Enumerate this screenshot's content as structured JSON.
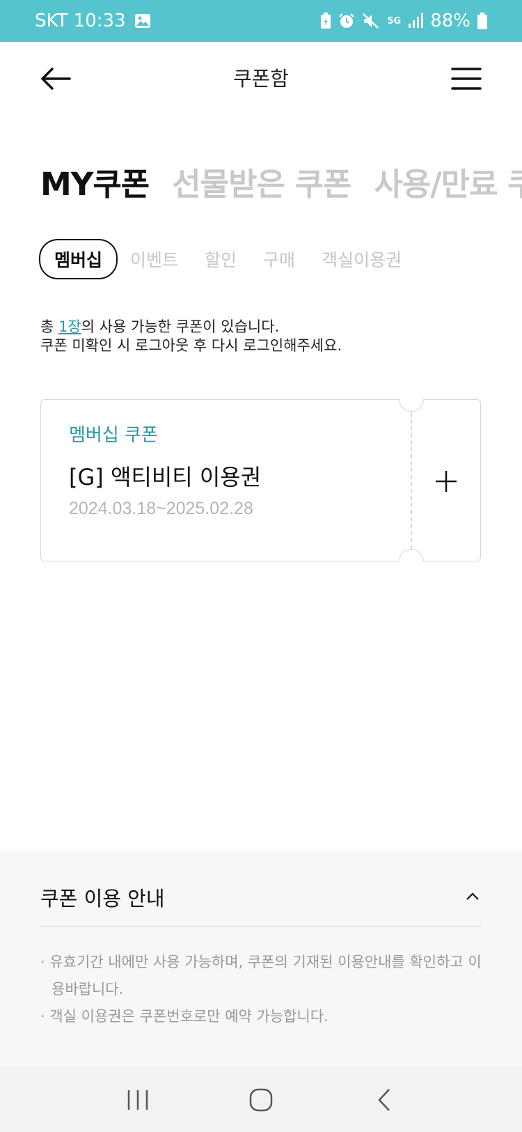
{
  "status_bar": {
    "carrier_time": "SKT 10:33",
    "network": "5G",
    "battery": "88%",
    "icons": [
      "image-icon",
      "battery-saver-icon",
      "alarm-icon",
      "mute-icon",
      "signal-icon",
      "battery-icon"
    ]
  },
  "header": {
    "title": "쿠폰함",
    "back_icon": "arrow-left-icon",
    "menu_icon": "hamburger-menu-icon"
  },
  "main_tabs": [
    {
      "label": "MY쿠폰",
      "active": true
    },
    {
      "label": "선물받은 쿠폰",
      "active": false
    },
    {
      "label": "사용/만료 쿠폰",
      "active": false
    }
  ],
  "sub_tabs": [
    {
      "label": "멤버십",
      "active": true
    },
    {
      "label": "이벤트",
      "active": false
    },
    {
      "label": "할인",
      "active": false
    },
    {
      "label": "구매",
      "active": false
    },
    {
      "label": "객실이용권",
      "active": false
    }
  ],
  "info": {
    "prefix": "총 ",
    "count": "1장",
    "suffix": "의 사용 가능한 쿠폰이 있습니다.",
    "line2": "쿠폰 미확인 시 로그아웃 후 다시 로그인해주세요."
  },
  "coupons": [
    {
      "category": "멤버십 쿠폰",
      "name": "[G] 액티비티 이용권",
      "period": "2024.03.18~2025.02.28",
      "action_icon": "plus-icon"
    }
  ],
  "guide": {
    "title": "쿠폰 이용 안내",
    "toggle_icon": "chevron-up-icon",
    "items": [
      "· 유효기간 내에만 사용 가능하며, 쿠폰의 기재된 이용안내를 확인하고 이용바랍니다.",
      "· 객실 이용권은 쿠폰번호로만 예약 가능합니다."
    ]
  },
  "nav_bar": {
    "icons": [
      "recent-apps-icon",
      "home-icon",
      "back-icon"
    ]
  },
  "colors": {
    "status_bar": "#56c4cd",
    "accent": "#2a9aa2",
    "inactive_tab": "#c9c9c9",
    "guide_bg": "#f7f7f8"
  }
}
